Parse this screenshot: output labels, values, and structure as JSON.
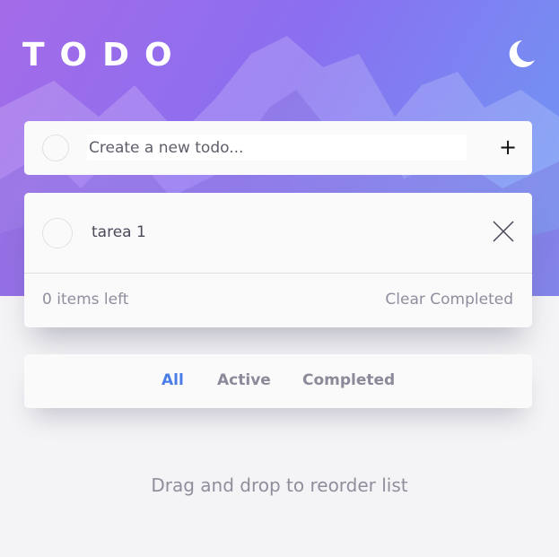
{
  "header": {
    "title": "TODO",
    "theme_toggle_icon": "moon-icon"
  },
  "new_todo": {
    "placeholder": "Create a new todo...",
    "value": "",
    "add_icon": "plus-icon",
    "add_label": "+"
  },
  "todos": [
    {
      "text": "tarea 1",
      "completed": false,
      "delete_icon": "close-icon"
    }
  ],
  "footer": {
    "items_left": "0 items left",
    "clear_completed": "Clear Completed"
  },
  "filters": [
    {
      "label": "All",
      "active": true
    },
    {
      "label": "Active",
      "active": false
    },
    {
      "label": "Completed",
      "active": false
    }
  ],
  "hint": "Drag and drop to reorder list",
  "colors": {
    "accent": "#4a7ce8",
    "background": "#f4f4f6",
    "card": "#fafafa",
    "hero_gradient_start": "#a46be8",
    "hero_gradient_end": "#6c9cf4"
  }
}
